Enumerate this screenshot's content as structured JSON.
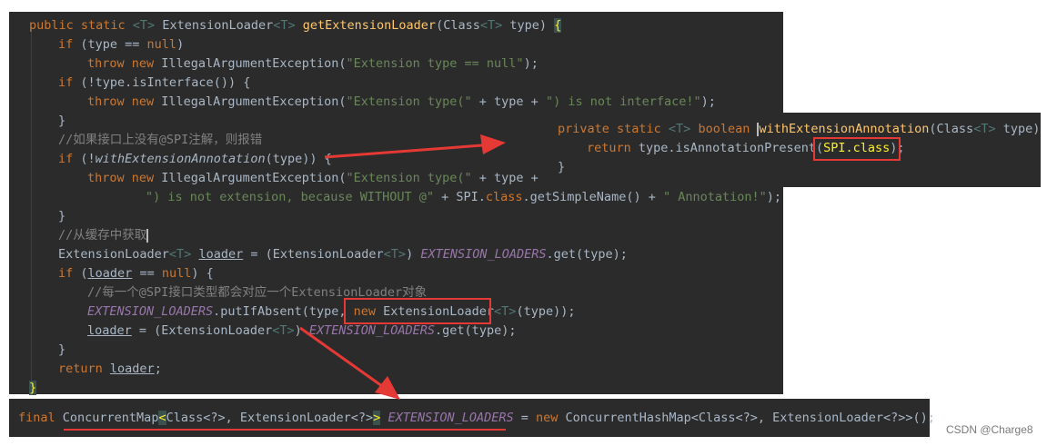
{
  "main_code": {
    "l1": {
      "kw": "public static ",
      "gen1": "<T>",
      "cls": " ExtensionLoader",
      "gen2": "<T>",
      "sp": " ",
      "fn": "getExtensionLoader",
      "args": "(Class",
      "gen3": "<T>",
      "args2": " type) ",
      "brace": "{"
    },
    "l2": {
      "kw": "if ",
      "p1": "(type == ",
      "nul": "null",
      "p2": ")"
    },
    "l3": {
      "kw": "throw new ",
      "cls": "IllegalArgumentException(",
      "str": "\"Extension type == null\"",
      "end": ");"
    },
    "l4": {
      "kw": "if ",
      "p1": "(!type.isInterface()) {"
    },
    "l5": {
      "kw": "throw new ",
      "cls": "IllegalArgumentException(",
      "str": "\"Extension type(\"",
      "mid": " + type + ",
      "str2": "\") is not interface!\"",
      "end": ");"
    },
    "l6": "}",
    "l7_comment": "//如果接口上没有@SPI注解，则报错",
    "l8": {
      "kw": "if ",
      "p1": "(!",
      "it": "withExtensionAnnotation",
      "p2": "(type)) {"
    },
    "l9": {
      "kw": "throw new ",
      "cls": "IllegalArgumentException(",
      "str": "\"Extension type(\"",
      "mid": " + type +"
    },
    "l10": {
      "str": "\") is not extension, because WITHOUT @\"",
      "mid": " + SPI.",
      "kw": "class",
      "mid2": ".getSimpleName() + ",
      "str2": "\" Annotation!\"",
      "end": ");"
    },
    "l11": "}",
    "l12_comment": "//从缓存中获取",
    "l13": {
      "cls": "ExtensionLoader",
      "gen1": "<T>",
      "sp": " ",
      "var": "loader",
      "mid": " = (ExtensionLoader",
      "gen2": "<T>",
      "mid2": ") ",
      "fld": "EXTENSION_LOADERS",
      "end": ".get(type);"
    },
    "l14": {
      "kw": "if ",
      "p1": "(",
      "var": "loader",
      "p2": " == ",
      "nul": "null",
      "p3": ") {"
    },
    "l15_comment": "//每一个@SPI接口类型都会对应一个ExtensionLoader对象",
    "l16": {
      "fld": "EXTENSION_LOADERS",
      "mid": ".putIfAbsent(type, ",
      "kw": "new ",
      "cls": "ExtensionLoader",
      "gen": "<T>",
      "end": "(type));"
    },
    "l17": {
      "var": "loader",
      "mid": " = (ExtensionLoader",
      "gen": "<T>",
      "mid2": ") ",
      "fld": "EXTENSION_LOADERS",
      "end": ".get(type);"
    },
    "l18": "}",
    "l19": {
      "kw": "return ",
      "var": "loader",
      "end": ";"
    },
    "l20": "}"
  },
  "popup_code": {
    "l1": {
      "kw": "private static ",
      "gen": "<T>",
      "kw2": " boolean ",
      "fn": "withExtensionAnnotation",
      "args": "(Class",
      "gen2": "<T>",
      "args2": " type) {"
    },
    "l2": {
      "kw": "return ",
      "mid": "type.isAnnotationPresent(",
      "hl": "SPI.class",
      "end": ");"
    },
    "l3": "}"
  },
  "bottom_code": {
    "kw": "final ",
    "cls": "ConcurrentMap",
    "lt": "<",
    "mid": "Class<?>, ExtensionLoader<?>",
    "gt": ">",
    "sp": " ",
    "fld": "EXTENSION_LOADERS",
    "eq": " = ",
    "kw2": "new ",
    "end": "ConcurrentHashMap<Class<?>, ExtensionLoader<?>>();"
  },
  "watermark": "CSDN @Charge8",
  "colors": {
    "editor_bg": "#2b2b2b",
    "keyword": "#cc7832",
    "string": "#6a8759",
    "method": "#ffc66d",
    "field": "#9876aa",
    "comment": "#808080",
    "annotation_red": "#e53935"
  }
}
